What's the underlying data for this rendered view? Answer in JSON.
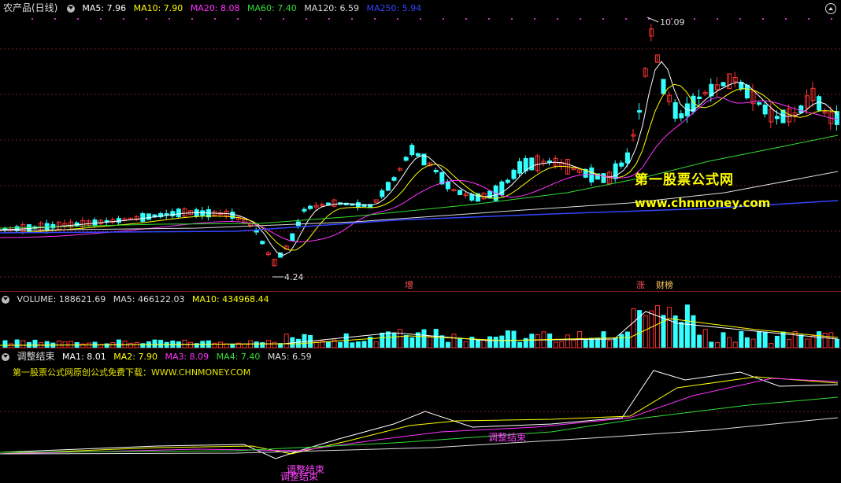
{
  "main": {
    "title": "农产品(日线)",
    "ma": [
      {
        "label": "MA5: 7.96",
        "color": "#ffffff"
      },
      {
        "label": "MA10: 7.90",
        "color": "#ffff00"
      },
      {
        "label": "MA20: 8.08",
        "color": "#ff33ff"
      },
      {
        "label": "MA60: 7.40",
        "color": "#33dd33"
      },
      {
        "label": "MA120: 6.59",
        "color": "#dddddd"
      },
      {
        "label": "MA250: 5.94",
        "color": "#3344ff"
      }
    ],
    "high_label": "10.09",
    "low_label": "4.24",
    "tag_zeng": "增",
    "tag_zhang": "涨",
    "tag_bang": "财榜",
    "watermark_cn": "第一股票公式网",
    "watermark_url": "www.chnmoney.com"
  },
  "volume": {
    "items": [
      {
        "label": "VOLUME: 188621.69",
        "color": "#dddddd"
      },
      {
        "label": "MA5: 466122.03",
        "color": "#dddddd"
      },
      {
        "label": "MA10: 434968.44",
        "color": "#ffff00"
      }
    ]
  },
  "indicator": {
    "title": "调整结束",
    "items": [
      {
        "label": "MA1: 8.01",
        "color": "#ffffff"
      },
      {
        "label": "MA2: 7.90",
        "color": "#ffff00"
      },
      {
        "label": "MA3: 8.09",
        "color": "#ff33ff"
      },
      {
        "label": "MA4: 7.40",
        "color": "#33dd33"
      },
      {
        "label": "MA5: 6.59",
        "color": "#dddddd"
      }
    ],
    "note": "第一股票公式网原创公式免费下载：WWW.CHNMONEY.COM",
    "signal_label": "调整结束"
  },
  "colors": {
    "up": "#ff3333",
    "down": "#33ffff",
    "grid": "#7a1c1c"
  }
}
